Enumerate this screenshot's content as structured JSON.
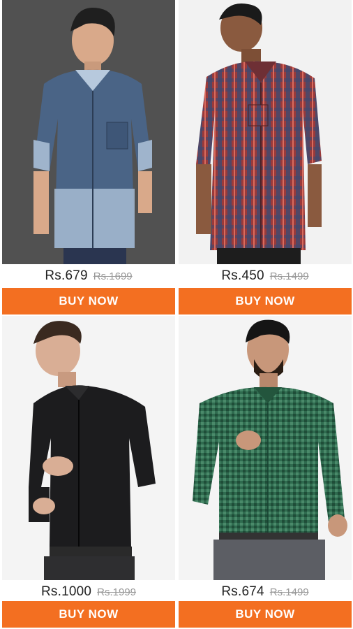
{
  "products": [
    {
      "price": "Rs.679",
      "mrp": "Rs.1699",
      "cta": "BUY NOW",
      "shirt_color": "#4a6486",
      "shirt_light": "#a7bcd4",
      "bg": "#4a4a4a"
    },
    {
      "price": "Rs.450",
      "mrp": "Rs.1499",
      "cta": "BUY NOW",
      "shirt_color": "#9a3a3a",
      "shirt_light": "#3f4a70",
      "bg": "#f2f2f2"
    },
    {
      "price": "Rs.1000",
      "mrp": "Rs.1999",
      "cta": "BUY NOW",
      "shirt_color": "#1c1c1e",
      "shirt_light": "#3a3a3c",
      "bg": "#f4f4f4"
    },
    {
      "price": "Rs.674",
      "mrp": "Rs.1499",
      "cta": "BUY NOW",
      "shirt_color": "#2f6b4f",
      "shirt_light": "#4a8a6a",
      "bg": "#f4f4f4"
    }
  ],
  "icons": {
    "buy": "buy-button",
    "photo": "product-photo"
  },
  "colors": {
    "accent": "#f36f21",
    "price_text": "#222222",
    "mrp_text": "#999999"
  }
}
